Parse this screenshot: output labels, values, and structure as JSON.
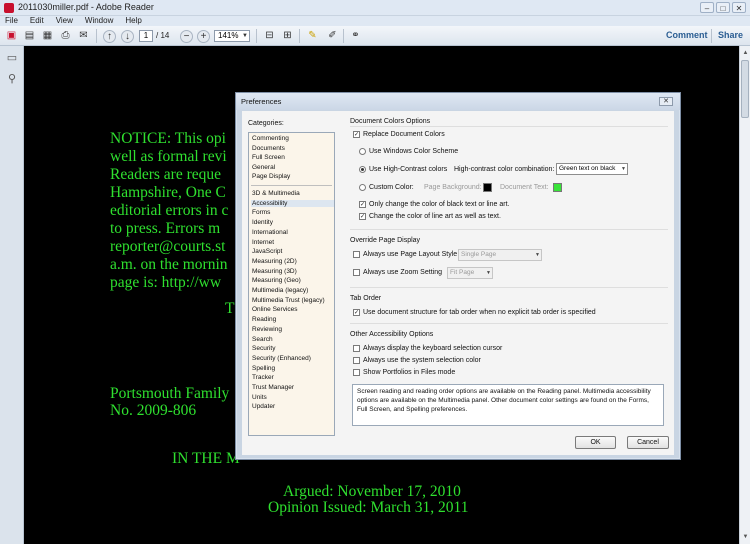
{
  "window": {
    "title": "2011030miller.pdf - Adobe Reader",
    "min": "–",
    "max": "□",
    "close": "✕"
  },
  "menu": [
    "File",
    "Edit",
    "View",
    "Window",
    "Help"
  ],
  "toolbar": {
    "page_current": "1",
    "page_total": "/ 14",
    "zoom": "141%",
    "comment_label": "Comment",
    "share_label": "Share"
  },
  "document": {
    "lines": [
      "NOTICE:  This opi",
      "well as formal revi",
      "Readers are reque",
      "Hampshire, One C",
      "editorial errors in c",
      "to press.  Errors m",
      "reporter@courts.st",
      "a.m. on the mornin",
      "page is: http://ww",
      "T",
      "Portsmouth Family",
      "No. 2009-806",
      "IN THE M",
      "Argued:  November 17, 2010",
      "Opinion Issued:  March 31, 2011"
    ]
  },
  "dialog": {
    "title": "Preferences",
    "categories_label": "Categories:",
    "categories_top": [
      "Commenting",
      "Documents",
      "Full Screen",
      "General",
      "Page Display"
    ],
    "categories": [
      "3D & Multimedia",
      "Accessibility",
      "Forms",
      "Identity",
      "International",
      "Internet",
      "JavaScript",
      "Measuring (2D)",
      "Measuring (3D)",
      "Measuring (Geo)",
      "Multimedia (legacy)",
      "Multimedia Trust (legacy)",
      "Online Services",
      "Reading",
      "Reviewing",
      "Search",
      "Security",
      "Security (Enhanced)",
      "Spelling",
      "Tracker",
      "Trust Manager",
      "Units",
      "Updater"
    ],
    "selected_category": "Accessibility",
    "doc_colors": {
      "heading": "Document Colors Options",
      "replace": "Replace Document Colors",
      "windows_scheme": "Use Windows Color Scheme",
      "high_contrast": "Use High-Contrast colors",
      "combination_label": "High-contrast color combination:",
      "combination_value": "Green text on black",
      "custom": "Custom Color:",
      "page_bg": "Page Background:",
      "doc_text": "Document Text:",
      "only_black": "Only change the color of black text or line art.",
      "line_art": "Change the color of line art as well as text.",
      "swatch_black": "#000000",
      "swatch_green": "#39e339"
    },
    "override": {
      "heading": "Override Page Display",
      "layout_label": "Always use Page Layout Style",
      "layout_value": "Single Page",
      "zoom_label": "Always use Zoom Setting",
      "zoom_value": "Fit Page"
    },
    "tab_order": {
      "heading": "Tab Order",
      "label": "Use document structure for tab order when no explicit tab order is specified"
    },
    "other": {
      "heading": "Other Accessibility Options",
      "keyboard_cursor": "Always display the keyboard selection cursor",
      "system_color": "Always use the system selection color",
      "portfolios": "Show Portfolios in Files mode"
    },
    "info": "Screen reading and reading order options are available on the Reading panel. Multimedia accessibility options are available on the Multimedia panel. Other document color settings are found on the Forms, Full Screen, and Spelling preferences.",
    "ok": "OK",
    "cancel": "Cancel"
  }
}
